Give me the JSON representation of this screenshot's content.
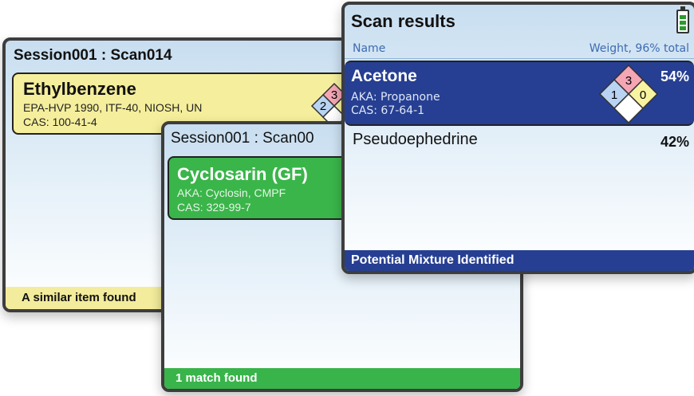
{
  "screen1": {
    "title": "Session001 : Scan014",
    "card": {
      "name": "Ethylbenzene",
      "line1": "EPA-HVP 1990, ITF-40, NIOSH, UN",
      "line2": "CAS: 100-41-4",
      "nfpa": {
        "health": "2",
        "fire": "3"
      }
    },
    "footer": "A similar item found",
    "colors": {
      "card": "#f5ee9c",
      "footer": "#f3ec9c"
    }
  },
  "screen2": {
    "title": "Session001 : Scan00",
    "card": {
      "name": "Cyclosarin (GF)",
      "line1": "AKA: Cyclosin, CMPF",
      "line2": "CAS: 329-99-7"
    },
    "footer": "1 match found",
    "colors": {
      "card": "#3ab54a",
      "footer": "#39b44a"
    }
  },
  "screen3": {
    "title": "Scan results",
    "columns": {
      "name": "Name",
      "weight": "Weight, 96% total"
    },
    "results": [
      {
        "name": "Acetone",
        "aka": "AKA: Propanone",
        "cas": "CAS: 67-64-1",
        "percent": "54%",
        "nfpa": {
          "health": "1",
          "fire": "3",
          "reactivity": "0"
        },
        "selected": true
      },
      {
        "name": "Pseudoephedrine",
        "percent": "42%",
        "selected": false
      }
    ],
    "footer": "Potential Mixture Identified",
    "colors": {
      "selected": "#263f92",
      "footer": "#263f92",
      "header_text": "#3d6bb3"
    }
  }
}
